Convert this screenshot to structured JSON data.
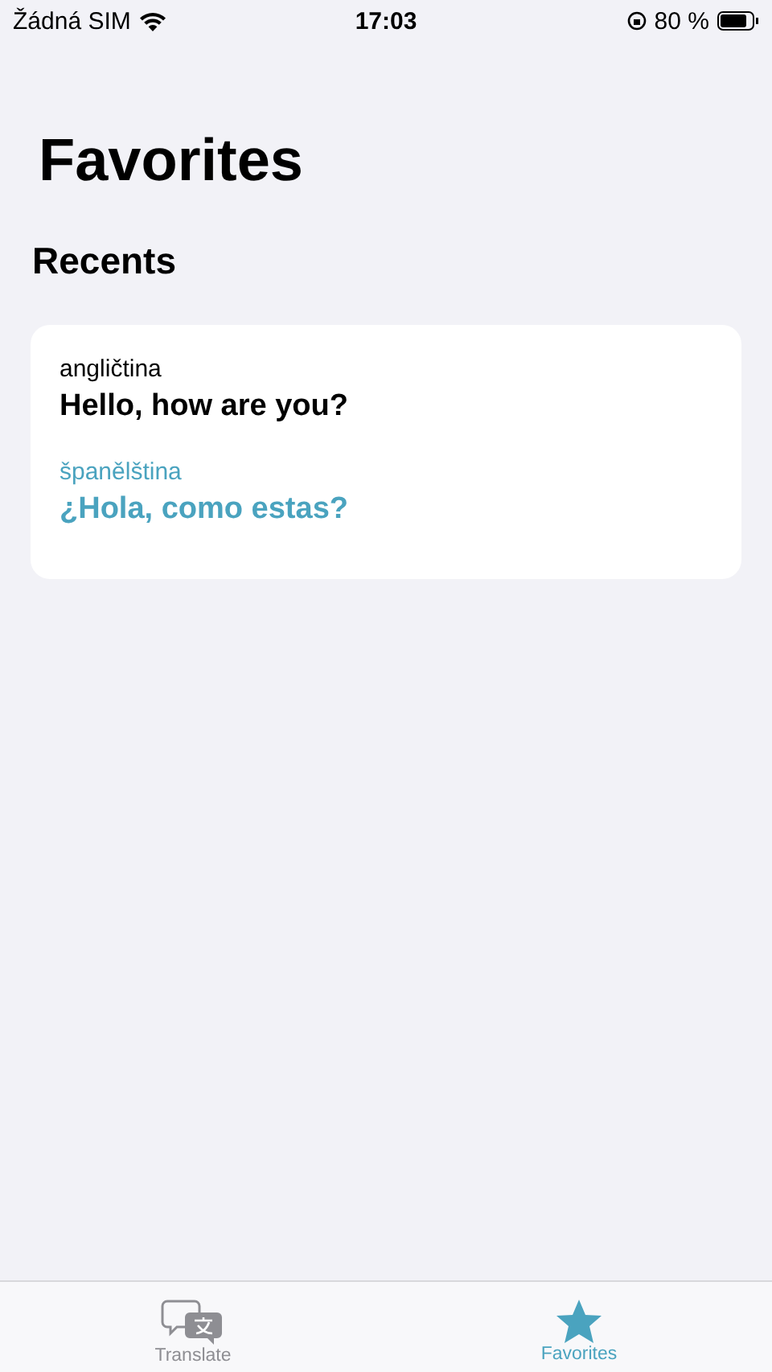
{
  "status_bar": {
    "carrier": "Žádná SIM",
    "time": "17:03",
    "battery": "80 %"
  },
  "title": "Favorites",
  "section": "Recents",
  "cards": [
    {
      "source_language": "angličtina",
      "source_text": "Hello, how are you?",
      "target_language": "španělština",
      "target_text": "¿Hola, como estas?"
    }
  ],
  "tabs": [
    {
      "kind": "translate",
      "label": "Translate",
      "selected": false
    },
    {
      "kind": "favorites",
      "label": "Favorites",
      "selected": true
    }
  ]
}
